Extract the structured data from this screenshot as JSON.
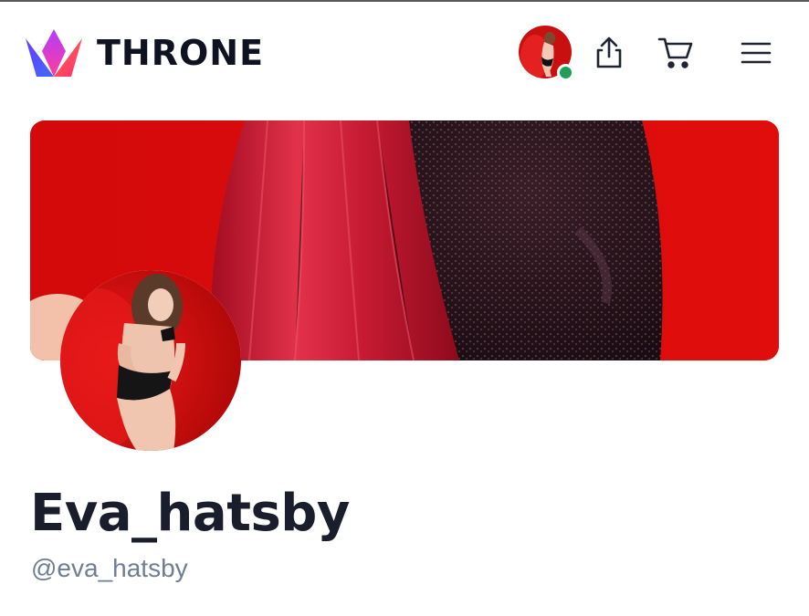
{
  "header": {
    "brand": "THRONE",
    "icons": {
      "logo": "crown-logo-icon",
      "share": "share-icon",
      "cart": "cart-icon",
      "menu": "hamburger-menu-icon"
    },
    "user_online": true
  },
  "profile": {
    "display_name": "Eva_hatsby",
    "handle": "@eva_hatsby"
  },
  "colors": {
    "brand_text": "#0f1220",
    "banner_red": "#d90b0b",
    "online_green": "#1e9e57",
    "handle_gray": "#6f7d95",
    "name_dark": "#1a1d2b"
  }
}
